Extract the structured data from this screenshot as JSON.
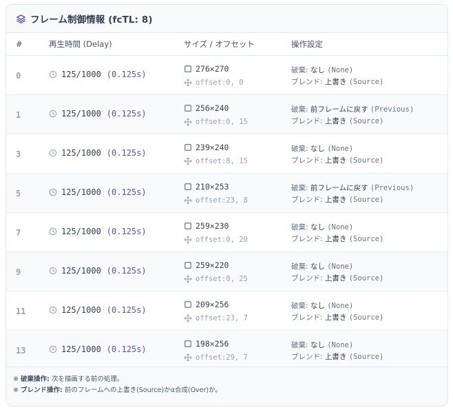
{
  "header": {
    "title": "フレーム制御情報 (fcTL: 8)"
  },
  "columns": {
    "index": "#",
    "delay": "再生時間 (Delay)",
    "size": "サイズ / オフセット",
    "ops": "操作設定"
  },
  "labels": {
    "dispose": "破棄:",
    "blend": "ブレンド:",
    "offset_prefix": "offset: "
  },
  "rows": [
    {
      "index": "0",
      "delay": "125/1000",
      "seconds": "(0.125s)",
      "size": "276×270",
      "offset": "0, 0",
      "dispose": "なし",
      "dispose_en": "(None)",
      "blend": "上書き",
      "blend_en": "(Source)"
    },
    {
      "index": "1",
      "delay": "125/1000",
      "seconds": "(0.125s)",
      "size": "256×240",
      "offset": "0, 15",
      "dispose": "前フレームに戻す",
      "dispose_en": "(Previous)",
      "blend": "上書き",
      "blend_en": "(Source)"
    },
    {
      "index": "3",
      "delay": "125/1000",
      "seconds": "(0.125s)",
      "size": "239×240",
      "offset": "8, 15",
      "dispose": "なし",
      "dispose_en": "(None)",
      "blend": "上書き",
      "blend_en": "(Source)"
    },
    {
      "index": "5",
      "delay": "125/1000",
      "seconds": "(0.125s)",
      "size": "210×253",
      "offset": "23, 8",
      "dispose": "前フレームに戻す",
      "dispose_en": "(Previous)",
      "blend": "上書き",
      "blend_en": "(Source)"
    },
    {
      "index": "7",
      "delay": "125/1000",
      "seconds": "(0.125s)",
      "size": "259×230",
      "offset": "0, 20",
      "dispose": "なし",
      "dispose_en": "(None)",
      "blend": "上書き",
      "blend_en": "(Source)"
    },
    {
      "index": "9",
      "delay": "125/1000",
      "seconds": "(0.125s)",
      "size": "259×220",
      "offset": "0, 25",
      "dispose": "なし",
      "dispose_en": "(None)",
      "blend": "上書き",
      "blend_en": "(Source)"
    },
    {
      "index": "11",
      "delay": "125/1000",
      "seconds": "(0.125s)",
      "size": "209×256",
      "offset": "23, 7",
      "dispose": "なし",
      "dispose_en": "(None)",
      "blend": "上書き",
      "blend_en": "(Source)"
    },
    {
      "index": "13",
      "delay": "125/1000",
      "seconds": "(0.125s)",
      "size": "198×256",
      "offset": "29, 7",
      "dispose": "なし",
      "dispose_en": "(None)",
      "blend": "上書き",
      "blend_en": "(Source)"
    }
  ],
  "footer": {
    "note1_mark": "※",
    "note1_term": "破棄操作:",
    "note1_text": "次を描画する前の処理。",
    "note2_mark": "※",
    "note2_term": "ブレンド操作:",
    "note2_text": "前のフレームへの上書き(Source)かα合成(Over)か。"
  },
  "icons": {
    "header": "layers-icon",
    "delay": "clock-icon",
    "size": "square-icon",
    "offset": "move-icon"
  },
  "colors": {
    "accent": "#5b4fc4",
    "muted": "#94a3b8",
    "border": "#e2e8f0"
  }
}
